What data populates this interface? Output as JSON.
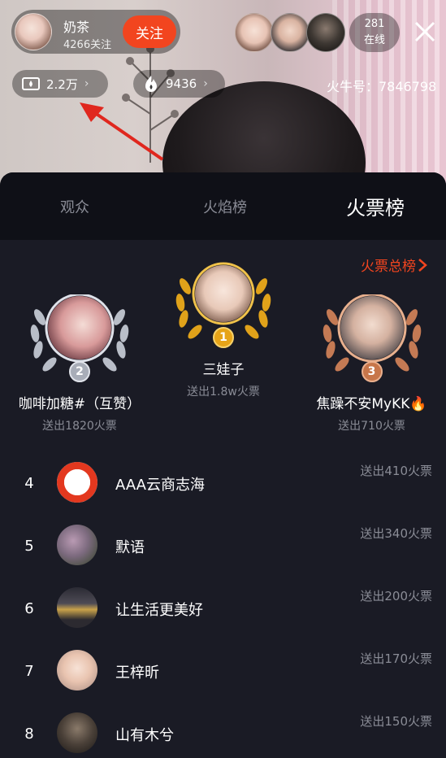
{
  "host": {
    "name": "奶茶",
    "follows": "4266关注",
    "follow_label": "关注"
  },
  "online": {
    "count": "281",
    "label": "在线"
  },
  "stats": {
    "heat_value": "2.2万",
    "fire_value": "9436",
    "chevron": "›"
  },
  "room": {
    "id_text": "火牛号：7846798"
  },
  "tabs": [
    {
      "label": "观众"
    },
    {
      "label": "火焰榜"
    },
    {
      "label": "火票榜"
    }
  ],
  "total_link": "火票总榜",
  "podium": [
    {
      "rank": "1",
      "name": "三娃子",
      "sent": "送出1.8w火票"
    },
    {
      "rank": "2",
      "name": "咖啡加糖#（互赞）",
      "sent": "送出1820火票"
    },
    {
      "rank": "3",
      "name": "焦躁不安MyKK🔥",
      "sent": "送出710火票"
    }
  ],
  "list": [
    {
      "rank": "4",
      "name": "AAA云商志海",
      "sent": "送出410火票"
    },
    {
      "rank": "5",
      "name": "默语",
      "sent": "送出340火票"
    },
    {
      "rank": "6",
      "name": "让生活更美好",
      "sent": "送出200火票"
    },
    {
      "rank": "7",
      "name": "王梓昕",
      "sent": "送出170火票"
    },
    {
      "rank": "8",
      "name": "山有木兮",
      "sent": "送出150火票"
    }
  ],
  "colors": {
    "accent": "#f2451f",
    "sheet": "#1a1b25",
    "tabs_bg": "#0f1017",
    "muted": "#8a8c96",
    "gold": "#e6a418",
    "silver": "#a8adb8",
    "bronze": "#c7764a"
  },
  "icons": {
    "close": "close-icon",
    "heat": "heat-ticket-icon",
    "fire": "fire-icon",
    "chevron": "chevron-right-icon"
  }
}
